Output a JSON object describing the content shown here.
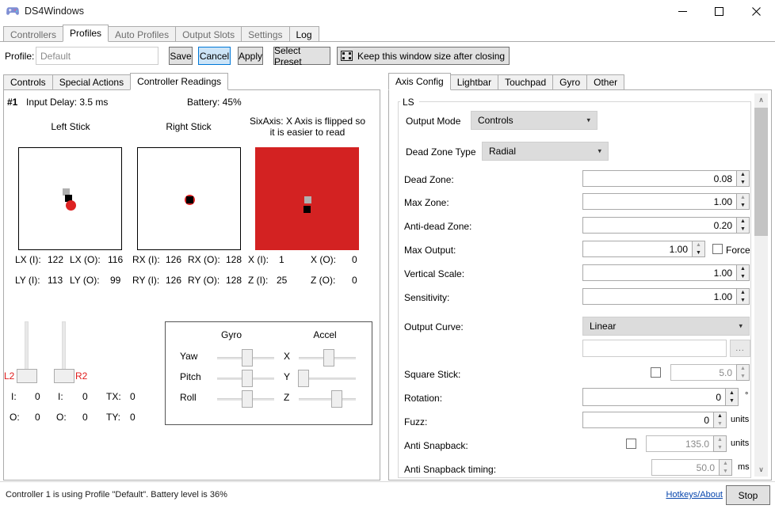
{
  "window": {
    "title": "DS4Windows",
    "icon": "gamepad-icon",
    "minimize": "—",
    "maximize": "□",
    "close": "✕"
  },
  "outer_tabs": [
    {
      "label": "Controllers",
      "selected": false,
      "enabled": false
    },
    {
      "label": "Profiles",
      "selected": true,
      "enabled": true
    },
    {
      "label": "Auto Profiles",
      "selected": false,
      "enabled": false
    },
    {
      "label": "Output Slots",
      "selected": false,
      "enabled": false
    },
    {
      "label": "Settings",
      "selected": false,
      "enabled": false
    },
    {
      "label": "Log",
      "selected": false,
      "enabled": true
    }
  ],
  "profile_row": {
    "label": "Profile:",
    "input_value": "Default",
    "save": "Save",
    "cancel": "Cancel",
    "apply": "Apply",
    "select_preset": "Select Preset",
    "keep_window": "Keep this window size after closing"
  },
  "inner_tabs": [
    {
      "label": "Controls",
      "selected": false
    },
    {
      "label": "Special Actions",
      "selected": false
    },
    {
      "label": "Controller Readings",
      "selected": true
    }
  ],
  "readings": {
    "controller_number": "#1",
    "input_delay": "Input Delay: 3.5 ms",
    "battery": "Battery: 45%",
    "left_stick_label": "Left Stick",
    "right_stick_label": "Right Stick",
    "sixaxis_label": "SixAxis: X Axis is flipped so it is easier to read",
    "axis_values": {
      "lx_i_label": "LX (I):",
      "lx_i": "122",
      "lx_o_label": "LX (O):",
      "lx_o": "116",
      "rx_i_label": "RX (I):",
      "rx_i": "126",
      "rx_o_label": "RX (O):",
      "rx_o": "128",
      "x_i_label": "X (I):",
      "x_i": "1",
      "x_o_label": "X (O):",
      "x_o": "0",
      "ly_i_label": "LY (I):",
      "ly_i": "113",
      "ly_o_label": "LY (O):",
      "ly_o": "99",
      "ry_i_label": "RY (I):",
      "ry_i": "126",
      "ry_o_label": "RY (O):",
      "ry_o": "128",
      "z_i_label": "Z (I):",
      "z_i": "25",
      "z_o_label": "Z (O):",
      "z_o": "0"
    },
    "triggers": {
      "l2_label": "L2",
      "r2_label": "R2",
      "l2_in_label": "I:",
      "l2_in": "0",
      "l2_out_label": "O:",
      "l2_out": "0",
      "r2_in_label": "I:",
      "r2_in": "0",
      "r2_out_label": "O:",
      "r2_out": "0",
      "tx_label": "TX:",
      "tx": "0",
      "ty_label": "TY:",
      "ty": "0"
    },
    "motion": {
      "gyro_header": "Gyro",
      "accel_header": "Accel",
      "gyro": [
        {
          "label": "Yaw",
          "position": 48
        },
        {
          "label": "Pitch",
          "position": 48
        },
        {
          "label": "Roll",
          "position": 48
        }
      ],
      "accel": [
        {
          "label": "X",
          "position": 48
        },
        {
          "label": "Y",
          "position": 1
        },
        {
          "label": "Z",
          "position": 58
        }
      ]
    },
    "colors": {
      "sixaxis_background": "#d32222",
      "stick_marker_input": "#dd2222",
      "stick_marker_raw": "#b0b0b0",
      "trigger_label": "#e01b1b"
    }
  },
  "right_tabs": [
    {
      "label": "Axis Config",
      "selected": true
    },
    {
      "label": "Lightbar",
      "selected": false
    },
    {
      "label": "Touchpad",
      "selected": false
    },
    {
      "label": "Gyro",
      "selected": false
    },
    {
      "label": "Other",
      "selected": false
    }
  ],
  "axis_config": {
    "group_title": "LS",
    "output_mode": {
      "label": "Output Mode",
      "value": "Controls"
    },
    "dead_zone_type": {
      "label": "Dead Zone Type",
      "value": "Radial"
    },
    "fields": [
      {
        "label": "Dead Zone:",
        "value": "0.08"
      },
      {
        "label": "Max Zone:",
        "value": "1.00"
      },
      {
        "label": "Anti-dead Zone:",
        "value": "0.20"
      },
      {
        "label": "Max Output:",
        "value": "1.00"
      },
      {
        "label": "Vertical Scale:",
        "value": "1.00"
      },
      {
        "label": "Sensitivity:",
        "value": "1.00"
      }
    ],
    "force": {
      "label": "Force",
      "checked": false
    },
    "output_curve": {
      "label": "Output Curve:",
      "value": "Linear",
      "custom_value": "",
      "browse_label": "..."
    },
    "square_stick": {
      "label": "Square Stick:",
      "value": "5.0",
      "checked": false
    },
    "rotation": {
      "label": "Rotation:",
      "value": "0",
      "unit": "°"
    },
    "fuzz": {
      "label": "Fuzz:",
      "value": "0",
      "unit": "units"
    },
    "anti_snapback": {
      "label": "Anti Snapback:",
      "value": "135.0",
      "unit": "units",
      "checked": false
    },
    "anti_snapback_timing": {
      "label": "Anti Snapback timing:",
      "value": "50.0",
      "unit": "ms"
    }
  },
  "scrollbar": {
    "up": "∧",
    "down": "∨",
    "thumb_top_pct": 0,
    "thumb_height_pct": 34
  },
  "status": {
    "text": "Controller 1 is using Profile \"Default\". Battery level is 36%",
    "hotkeys": "Hotkeys/About",
    "stop": "Stop"
  }
}
